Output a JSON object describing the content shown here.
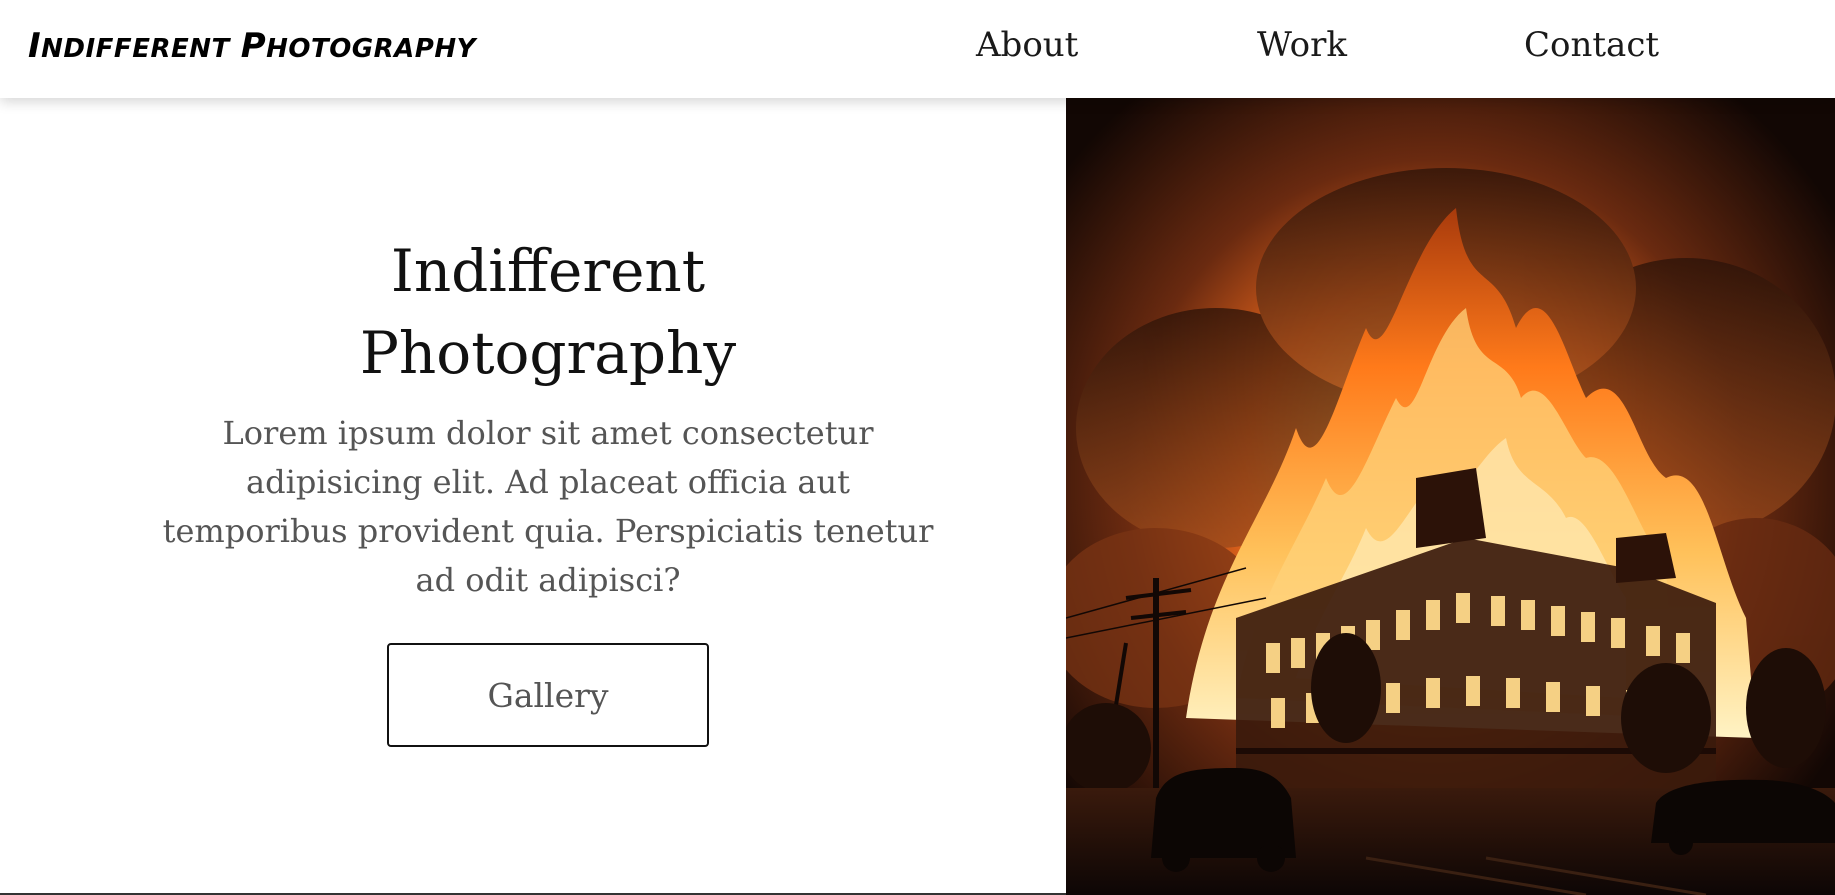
{
  "header": {
    "brand": {
      "first_initial": "I",
      "first_rest": "NDIFFERENT",
      "second_initial": "P",
      "second_rest": "HOTOGRAPHY"
    },
    "nav": [
      {
        "label": "About"
      },
      {
        "label": "Work"
      },
      {
        "label": "Contact"
      }
    ]
  },
  "hero": {
    "title_line1": "Indifferent",
    "title_line2": "Photography",
    "text": "Lorem ipsum dolor sit amet consectetur adipisicing elit. Ad placeat officia aut temporibus provident quia. Perspiciatis tenetur ad odit adipisci?",
    "button_label": "Gallery"
  },
  "image": {
    "subject": "building-on-fire-at-night-photo"
  },
  "colors": {
    "text": "#111111",
    "muted_text": "#555555",
    "background": "#ffffff",
    "fire_orange": "#ff7a1a",
    "night_sky": "#140905"
  }
}
